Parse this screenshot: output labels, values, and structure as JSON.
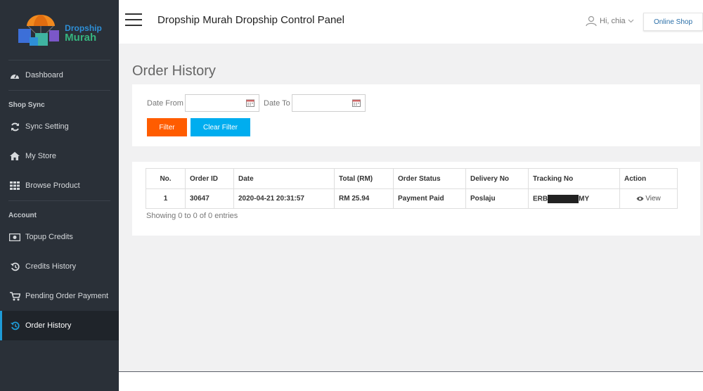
{
  "brand": {
    "line1": "Dropship",
    "line2": "Murah"
  },
  "sidebar": {
    "items": [
      {
        "label": "Dashboard"
      },
      {
        "section": "Shop Sync"
      },
      {
        "label": "Sync Setting"
      },
      {
        "label": "My Store"
      },
      {
        "label": "Browse Product"
      },
      {
        "section": "Account"
      },
      {
        "label": "Topup Credits"
      },
      {
        "label": "Credits History"
      },
      {
        "label": "Pending Order Payment"
      },
      {
        "label": "Order History"
      }
    ]
  },
  "header": {
    "title": "Dropship Murah Dropship Control Panel",
    "user_greeting": "Hi, chia",
    "online_shop": "Online Shop"
  },
  "page": {
    "title": "Order History"
  },
  "filter": {
    "date_from_label": "Date From",
    "date_to_label": "Date To",
    "date_from_value": "",
    "date_to_value": "",
    "filter_button": "Filter",
    "clear_button": "Clear Filter"
  },
  "table": {
    "columns": [
      "No.",
      "Order ID",
      "Date",
      "Total (RM)",
      "Order Status",
      "Delivery No",
      "Tracking No",
      "Action"
    ],
    "rows": [
      {
        "no": "1",
        "order_id": "30647",
        "date": "2020-04-21 20:31:57",
        "total": "RM 25.94",
        "status": "Payment Paid",
        "delivery": "Poslaju",
        "tracking_prefix": "ERB",
        "tracking_suffix": "MY",
        "action": "View"
      }
    ],
    "summary": "Showing 0 to 0 of 0 entries"
  },
  "colors": {
    "sidebar_bg": "#2a3038",
    "active_accent": "#1e9bd7",
    "filter_btn": "#ff5c00",
    "clear_btn": "#00adef"
  }
}
